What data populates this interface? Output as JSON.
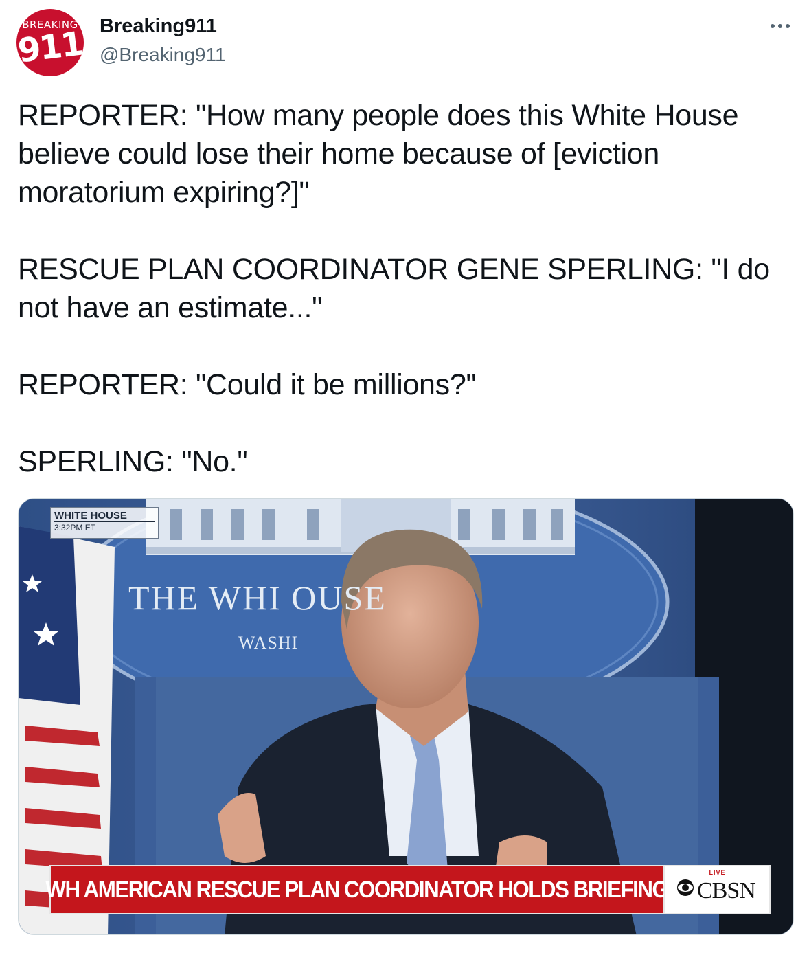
{
  "author": {
    "display_name": "Breaking911",
    "handle": "@Breaking911",
    "avatar": {
      "top_text": "BREAKING",
      "number": "911",
      "color": "#c8102e"
    }
  },
  "menu_icon": "more-horizontal-icon",
  "tweet": {
    "paragraphs": [
      "REPORTER: \"How many people does this White House believe could lose their home because of [eviction moratorium expiring?]\"",
      "RESCUE PLAN COORDINATOR GENE SPERLING: \"I do not have an estimate...\"",
      "REPORTER: \"Could it be millions?\"",
      "SPERLING: \"No.\""
    ]
  },
  "media": {
    "location_bug": {
      "title": "WHITE HOUSE",
      "time": "3:32PM  ET"
    },
    "backdrop": {
      "line1": "THE WHI          OUSE",
      "line2": "WASHI"
    },
    "chyron": "WH AMERICAN RESCUE PLAN COORDINATOR HOLDS BRIEFING",
    "network": {
      "live_label": "LIVE",
      "name": "CBSN"
    },
    "colors": {
      "chyron": "#c4161c",
      "backdrop": "#2d4f86"
    }
  }
}
